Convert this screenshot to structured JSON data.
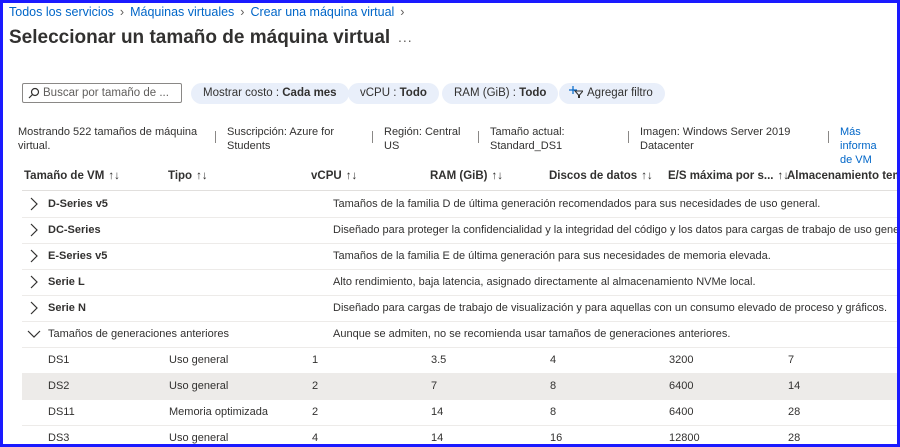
{
  "breadcrumb": [
    "Todos los servicios",
    "Máquinas virtuales",
    "Crear una máquina virtual"
  ],
  "page_title": "Seleccionar un tamaño de máquina virtual",
  "more_label": "...",
  "search": {
    "placeholder": "Buscar por tamaño de ..."
  },
  "filters": [
    {
      "label": "Mostrar costo : ",
      "value": "Cada mes"
    },
    {
      "label": "vCPU : ",
      "value": "Todo"
    },
    {
      "label": "RAM (GiB) : ",
      "value": "Todo"
    }
  ],
  "add_filter_label": "Agregar filtro",
  "info": {
    "showing": [
      "Mostrando 522 tamaños de máquina",
      "virtual."
    ],
    "subscription": [
      "Suscripción: Azure for",
      "Students"
    ],
    "region": [
      "Región: Central",
      "US"
    ],
    "current_size": [
      "Tamaño actual:",
      "Standard_DS1"
    ],
    "image": [
      "Imagen: Windows Server 2019",
      "Datacenter"
    ],
    "more_info": [
      "Más informa",
      "de VM"
    ]
  },
  "columns": [
    "Tamaño de VM",
    "Tipo",
    "vCPU",
    "RAM (GiB)",
    "Discos de datos",
    "E/S máxima por s...",
    "Almacenamiento tem..."
  ],
  "sort_icon": "↑↓",
  "groups": [
    {
      "name": "D-Series v5",
      "description": "Tamaños de la familia D de última generación recomendados para sus necesidades de uso general.",
      "expanded": false
    },
    {
      "name": "DC-Series",
      "description": "Diseñado para proteger la confidencialidad y la integridad del código y los datos para cargas de trabajo de uso general",
      "expanded": false
    },
    {
      "name": "E-Series v5",
      "description": "Tamaños de la familia E de última generación para sus necesidades de memoria elevada.",
      "expanded": false
    },
    {
      "name": "Serie L",
      "description": "Alto rendimiento, baja latencia, asignado directamente al almacenamiento NVMe local.",
      "expanded": false
    },
    {
      "name": "Serie N",
      "description": "Diseñado para cargas de trabajo de visualización y para aquellas con un consumo elevado de proceso y gráficos.",
      "expanded": false
    },
    {
      "name": "Tamaños de generaciones anteriores",
      "description": "Aunque se admiten, no se recomienda usar tamaños de generaciones anteriores.",
      "expanded": true
    }
  ],
  "rows": [
    {
      "size": "DS1",
      "type": "Uso general",
      "vcpu": "1",
      "ram": "3.5",
      "disks": "4",
      "iops": "3200",
      "temp": "7",
      "selected": false
    },
    {
      "size": "DS2",
      "type": "Uso general",
      "vcpu": "2",
      "ram": "7",
      "disks": "8",
      "iops": "6400",
      "temp": "14",
      "selected": true
    },
    {
      "size": "DS11",
      "type": "Memoria optimizada",
      "vcpu": "2",
      "ram": "14",
      "disks": "8",
      "iops": "6400",
      "temp": "28",
      "selected": false
    },
    {
      "size": "DS3",
      "type": "Uso general",
      "vcpu": "4",
      "ram": "14",
      "disks": "16",
      "iops": "12800",
      "temp": "28",
      "selected": false
    }
  ],
  "colors": {
    "link": "#0066c8",
    "pill_bg": "#e9effa",
    "selected_row": "#edebe9",
    "frame": "#1a1aff"
  }
}
